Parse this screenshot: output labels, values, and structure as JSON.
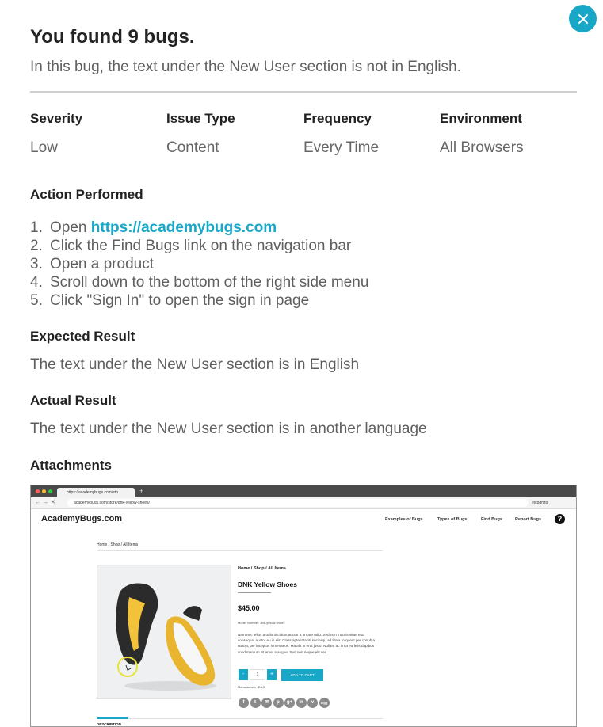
{
  "modal": {
    "title": "You found 9 bugs.",
    "subtitle": "In this bug, the text under the New User section is not in English.",
    "close_icon": "close-icon"
  },
  "meta": [
    {
      "label": "Severity",
      "value": "Low"
    },
    {
      "label": "Issue Type",
      "value": "Content"
    },
    {
      "label": "Frequency",
      "value": "Every Time"
    },
    {
      "label": "Environment",
      "value": "All Browsers"
    }
  ],
  "action": {
    "heading": "Action Performed",
    "steps": [
      {
        "num": "1.",
        "text": "Open ",
        "link": "https://academybugs.com"
      },
      {
        "num": "2.",
        "text": "Click the Find Bugs link on the navigation bar"
      },
      {
        "num": "3.",
        "text": "Open a product"
      },
      {
        "num": "4.",
        "text": "Scroll down to the bottom of the right side menu"
      },
      {
        "num": "5.",
        "text": "Click \"Sign In\" to open the sign in page"
      }
    ]
  },
  "expected": {
    "heading": "Expected Result",
    "text": "The text under the New User section is in English"
  },
  "actual": {
    "heading": "Actual Result",
    "text": "The text under the New User section is in another language"
  },
  "attachments": {
    "heading": "Attachments",
    "screenshot": {
      "tab_title": "https://academybugs.com/sto",
      "url": "academybugs.com/store/dnk-yellow-shoes/",
      "incognito_label": "Incognito",
      "site_logo": "AcademyBugs.com",
      "nav_links": [
        "Examples of Bugs",
        "Types of Bugs",
        "Find Bugs",
        "Report Bugs"
      ],
      "breadcrumb_top": "Home / Shop / All Items",
      "breadcrumb": "Home / Shop / All Items",
      "product_name": "DNK Yellow Shoes",
      "price": "$45.00",
      "model": "Model Number: dnk-yellow-shoes",
      "description": "Nam nec tellus a odio tincidunt auctor a ornare odio. Sed non mauris vitae erat consequat auctor eu in elit. Class aptent taciti sociosqu ad litora torquent per conubia nostra, per inceptos himenaeos. Mauris in erat justo. Nullam ac urna eu felis dapibus condimentum sit amet a augue. Sed non neque elit sed.",
      "qty_minus": "-",
      "quantity": "1",
      "qty_plus": "+",
      "add_to_cart": "ADD TO CART",
      "manufacturer": "Manufacturer: DNK",
      "share_icons": [
        "f",
        "t",
        "✉",
        "p",
        "g+",
        "in",
        "v",
        "digg"
      ],
      "description_tab": "DESCRIPTION",
      "accent_color": "#19a7c8"
    }
  }
}
